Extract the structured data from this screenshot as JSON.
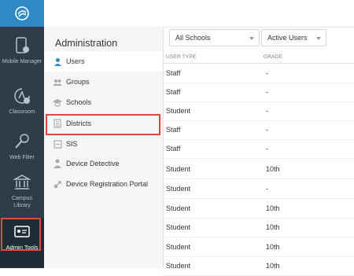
{
  "rail": {
    "items": [
      {
        "label": "Mobile Manager",
        "icon": "mobile-manager-icon"
      },
      {
        "label": "Classroom",
        "icon": "classroom-icon"
      },
      {
        "label": "Web Filter",
        "icon": "web-filter-icon"
      },
      {
        "label": "Campus Library",
        "icon": "campus-library-icon"
      },
      {
        "label": "Admin Tools",
        "icon": "admin-tools-icon"
      }
    ]
  },
  "admin": {
    "title": "Administration",
    "items": [
      {
        "label": "Users",
        "icon": "user-icon"
      },
      {
        "label": "Groups",
        "icon": "groups-icon"
      },
      {
        "label": "Schools",
        "icon": "school-icon"
      },
      {
        "label": "Districts",
        "icon": "districts-icon"
      },
      {
        "label": "SIS",
        "icon": "sis-icon"
      },
      {
        "label": "Device Detective",
        "icon": "device-detective-icon"
      },
      {
        "label": "Device Registration Portal",
        "icon": "device-registration-icon"
      }
    ]
  },
  "filters": {
    "schools": "All Schools",
    "status": "Active Users"
  },
  "table": {
    "headers": [
      "USER TYPE",
      "GRADE"
    ],
    "rows": [
      [
        "Staff",
        "-"
      ],
      [
        "Staff",
        "-"
      ],
      [
        "Student",
        "-"
      ],
      [
        "Staff",
        "-"
      ],
      [
        "Staff",
        "-"
      ],
      [
        "Student",
        "10th"
      ],
      [
        "Student",
        "-"
      ],
      [
        "Student",
        "10th"
      ],
      [
        "Student",
        "10th"
      ],
      [
        "Student",
        "10th"
      ],
      [
        "Student",
        "10th"
      ]
    ]
  },
  "colors": {
    "rail": "#2e3d4a",
    "logo": "#2f89c4",
    "highlight": "#e04a3a"
  }
}
